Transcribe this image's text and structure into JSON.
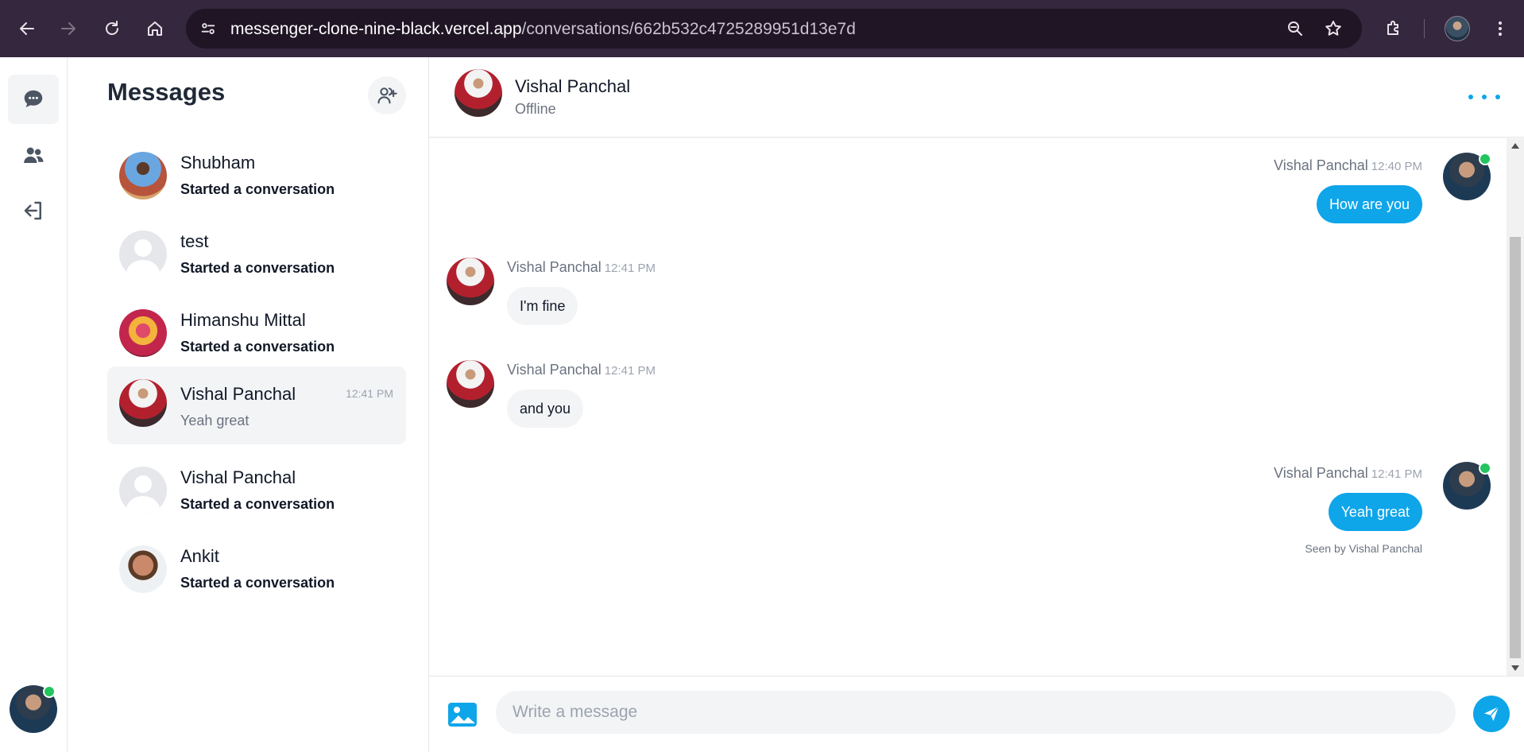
{
  "browser": {
    "url_host": "messenger-clone-nine-black.vercel.app",
    "url_path": "/conversations/662b532c4725289951d13e7d",
    "icons": [
      "back-icon",
      "forward-icon",
      "reload-icon",
      "home-icon",
      "site-info-icon",
      "zoom-icon",
      "star-icon",
      "extensions-icon",
      "profile-avatar",
      "menu-icon"
    ]
  },
  "rail": {
    "items": [
      {
        "name": "chat-icon",
        "active": true
      },
      {
        "name": "users-icon",
        "active": false
      },
      {
        "name": "logout-icon",
        "active": false
      }
    ]
  },
  "list": {
    "title": "Messages",
    "add_button_icon": "user-add-icon",
    "conversations": [
      {
        "name": "Shubham",
        "preview": "Started a conversation",
        "time": ""
      },
      {
        "name": "test",
        "preview": "Started a conversation",
        "time": ""
      },
      {
        "name": "Himanshu Mittal",
        "preview": "Started a conversation",
        "time": ""
      },
      {
        "name": "Vishal Panchal",
        "preview": "Yeah great",
        "time": "12:41 PM",
        "selected": true
      },
      {
        "name": "Vishal Panchal",
        "preview": "Started a conversation",
        "time": ""
      },
      {
        "name": "Ankit",
        "preview": "Started a conversation",
        "time": ""
      }
    ]
  },
  "chat": {
    "header": {
      "name": "Vishal Panchal",
      "status": "Offline"
    },
    "messages": [
      {
        "sender": "Vishal Panchal",
        "time": "12:40 PM",
        "text": "How are you",
        "own": true
      },
      {
        "sender": "Vishal Panchal",
        "time": "12:41 PM",
        "text": "I'm fine",
        "own": false
      },
      {
        "sender": "Vishal Panchal",
        "time": "12:41 PM",
        "text": "and you",
        "own": false
      },
      {
        "sender": "Vishal Panchal",
        "time": "12:41 PM",
        "text": "Yeah great",
        "own": true
      }
    ],
    "seen_text": "Seen by Vishal Panchal",
    "composer": {
      "placeholder": "Write a message"
    }
  },
  "colors": {
    "accent": "#0ea5e9",
    "online": "#22c55e",
    "chrome": "#35273d"
  }
}
